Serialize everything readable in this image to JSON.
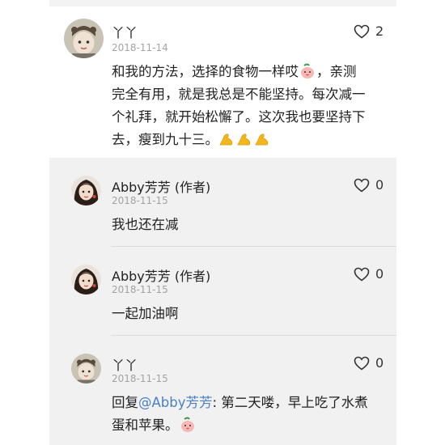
{
  "main_comment": {
    "author": "丫丫",
    "date": "2018-11-14",
    "likes": "2",
    "text_lines": [
      "和我的方法，选择的食物一样哎",
      "，亲测",
      "完全有用，就是我总是不能坚持。每次减一",
      "个礼拜，就开始松懈了。这次我也要坚持下",
      "去，瘦到九十三。"
    ],
    "emoji_inline": "peach-face-emoji",
    "emoji_end": [
      "flexed-biceps-emoji",
      "flexed-biceps-emoji",
      "flexed-biceps-emoji"
    ]
  },
  "replies": [
    {
      "author": "Abby芳芳 (作者)",
      "date": "2018-11-15",
      "likes": "0",
      "text": "我也还在减"
    },
    {
      "author": "Abby芳芳 (作者)",
      "date": "2018-11-15",
      "likes": "0",
      "text": "一起加油啊"
    },
    {
      "author": "丫丫",
      "date": "2018-11-15",
      "likes": "0",
      "reply_prefix": "回复",
      "mention": "@Abby芳芳",
      "text_line1": ": 第二天喽，早上吃了水煮",
      "text_line2": "蛋和苹果。",
      "emoji_end": "peach-face-emoji"
    }
  ],
  "colors": {
    "mention": "#4a7fc3",
    "reply_bg": "#f2f1f2",
    "date": "#a3a3a3",
    "flex": "#f2b81b"
  }
}
